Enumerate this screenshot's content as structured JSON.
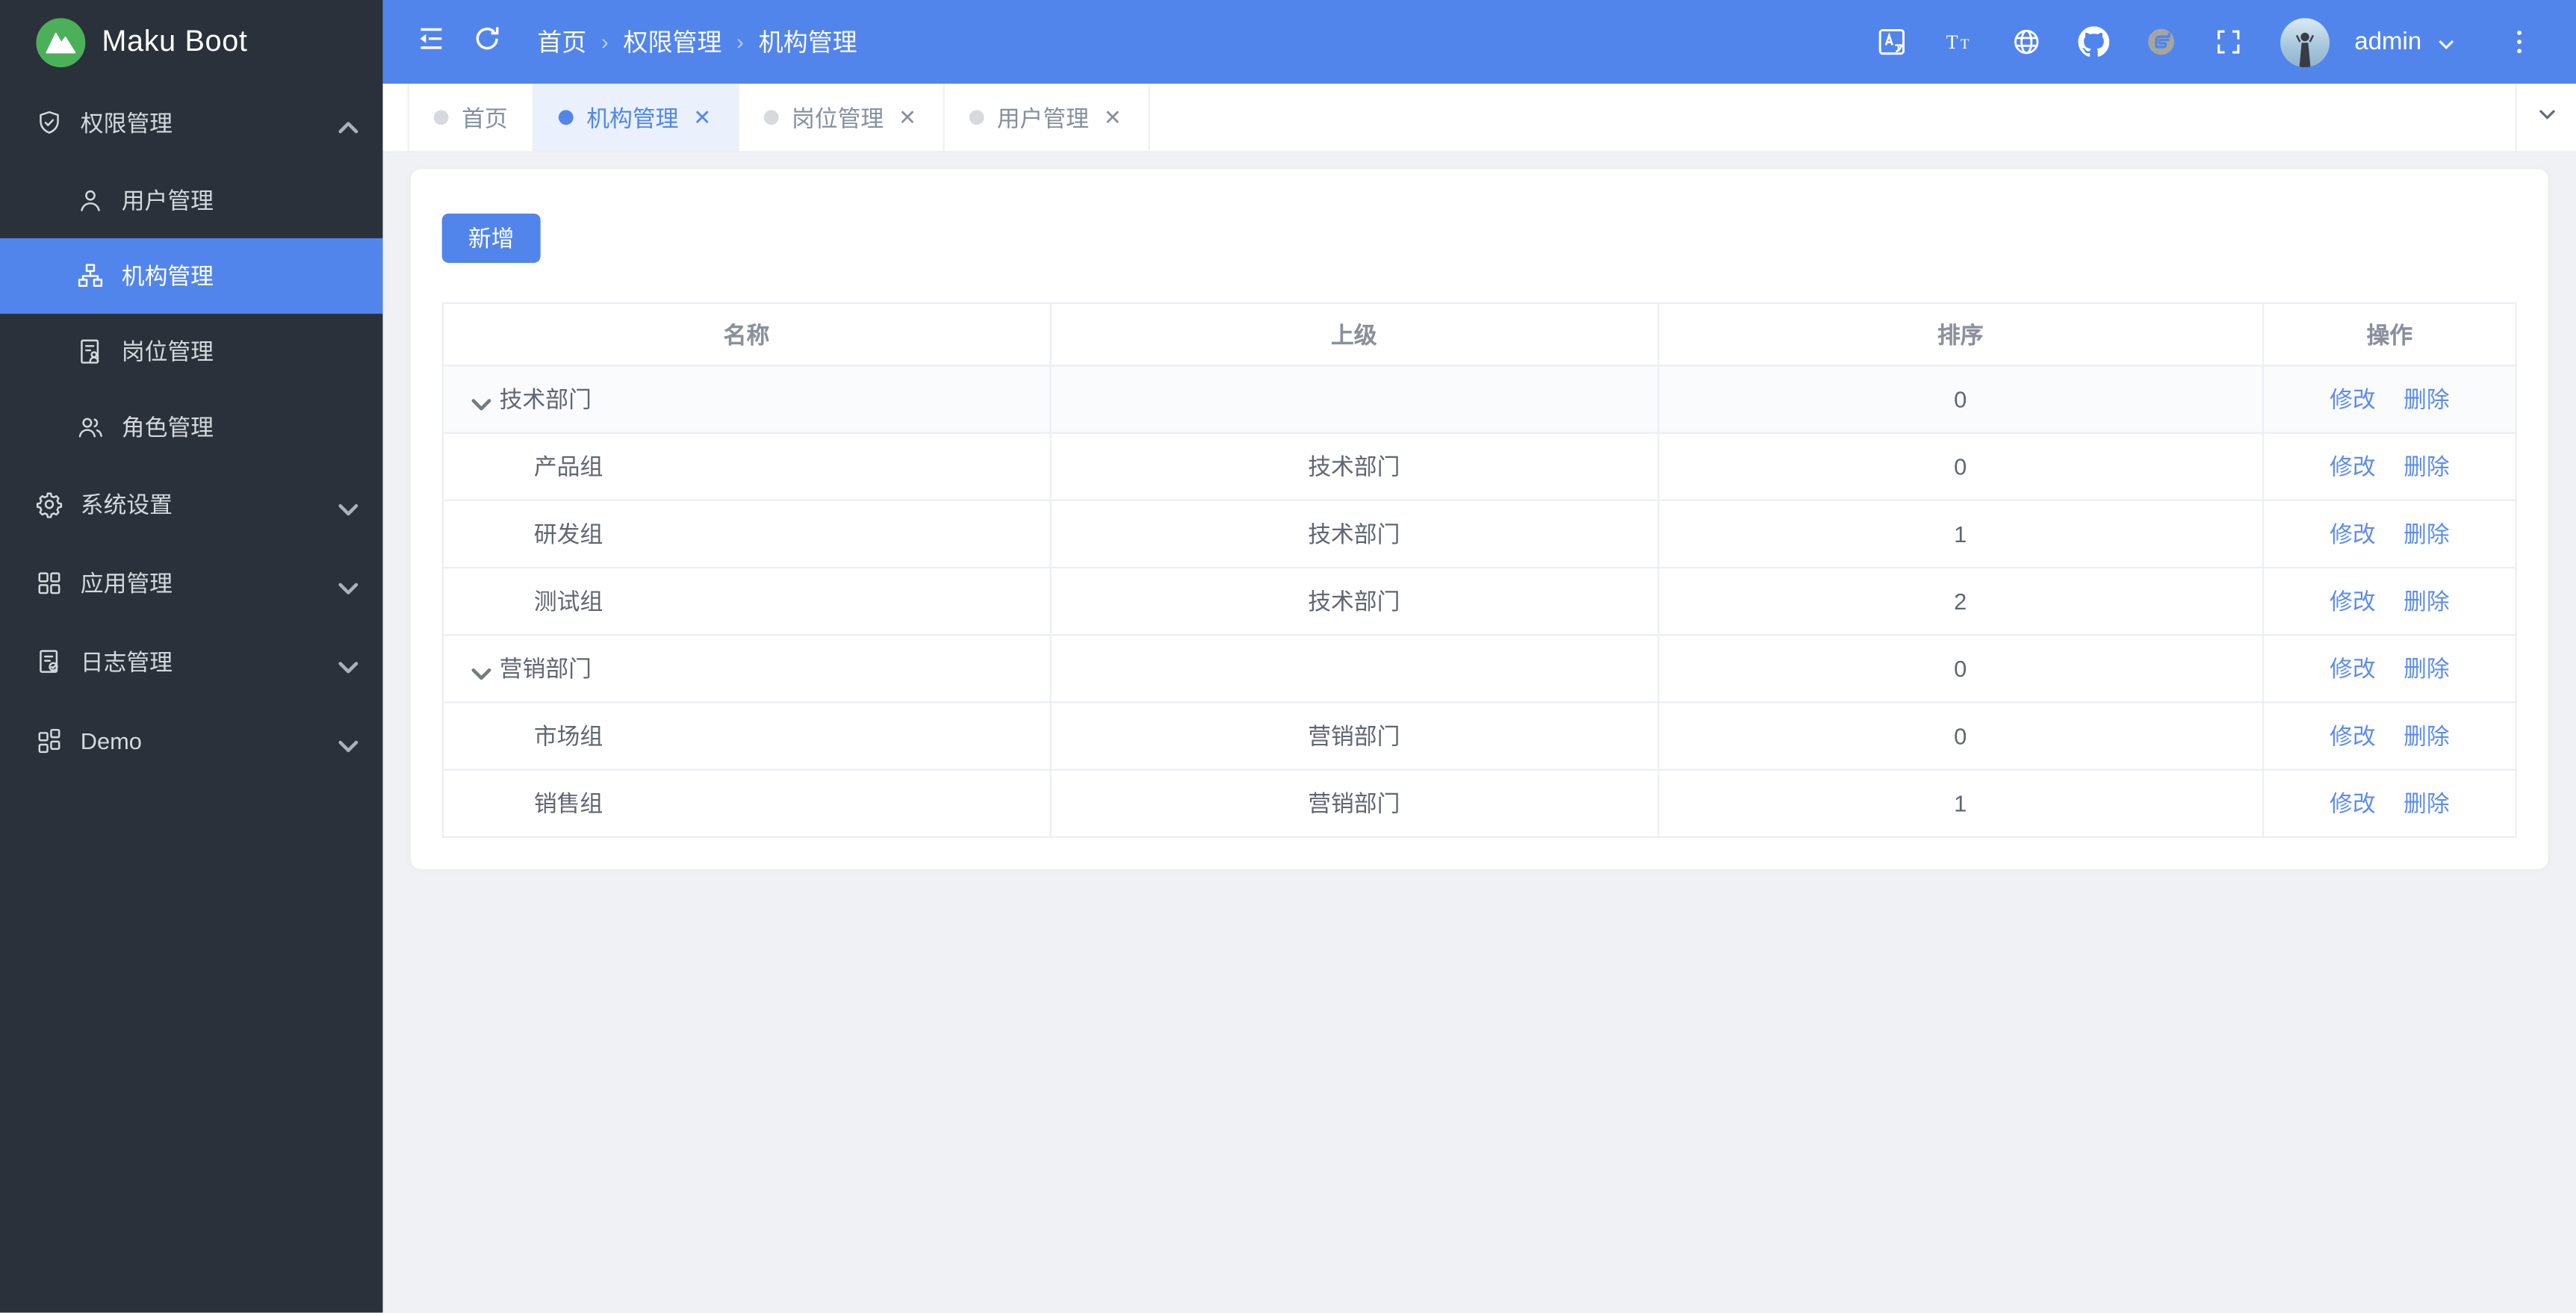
{
  "app": {
    "name": "Maku Boot"
  },
  "colors": {
    "primary": "#5285ec",
    "sidebar_bg": "#2a313a",
    "content_bg": "#eff1f5",
    "active_tab_bg": "#eaf1fc",
    "table_border": "#ebeef5",
    "link": "#5d8cee",
    "logo_green": "#4cb05a",
    "gitee_gray": "#a5a59e"
  },
  "sidebar": {
    "items": [
      {
        "key": "permission",
        "label": "权限管理",
        "icon": "shield",
        "type": "group",
        "expanded": true,
        "children": [
          {
            "key": "user",
            "label": "用户管理",
            "icon": "user",
            "active": false
          },
          {
            "key": "org",
            "label": "机构管理",
            "icon": "org",
            "active": true
          },
          {
            "key": "post",
            "label": "岗位管理",
            "icon": "post",
            "active": false
          },
          {
            "key": "role",
            "label": "角色管理",
            "icon": "role",
            "active": false
          }
        ]
      },
      {
        "key": "system",
        "label": "系统设置",
        "icon": "gear",
        "type": "group",
        "expanded": false,
        "children": []
      },
      {
        "key": "apps",
        "label": "应用管理",
        "icon": "apps",
        "type": "group",
        "expanded": false,
        "children": []
      },
      {
        "key": "logs",
        "label": "日志管理",
        "icon": "log",
        "type": "group",
        "expanded": false,
        "children": []
      },
      {
        "key": "demo",
        "label": "Demo",
        "icon": "demo",
        "type": "group",
        "expanded": false,
        "children": []
      }
    ]
  },
  "header": {
    "breadcrumb": [
      "首页",
      "权限管理",
      "机构管理"
    ],
    "right_icons": [
      "translate",
      "fontsize",
      "globe",
      "github",
      "gitee",
      "fullscreen"
    ],
    "user": {
      "name": "admin"
    }
  },
  "tabs": [
    {
      "key": "home",
      "label": "首页",
      "active": false,
      "closable": false
    },
    {
      "key": "org",
      "label": "机构管理",
      "active": true,
      "closable": true
    },
    {
      "key": "post",
      "label": "岗位管理",
      "active": false,
      "closable": true
    },
    {
      "key": "user",
      "label": "用户管理",
      "active": false,
      "closable": true
    }
  ],
  "main": {
    "add_button": "新增",
    "table": {
      "columns": [
        "名称",
        "上级",
        "排序",
        "操作"
      ],
      "action_labels": [
        "修改",
        "删除"
      ],
      "rows": [
        {
          "name": "技术部门",
          "parent": "",
          "sort": "0",
          "level": 0,
          "expandable": true,
          "hovered": true
        },
        {
          "name": "产品组",
          "parent": "技术部门",
          "sort": "0",
          "level": 1,
          "expandable": false,
          "hovered": false
        },
        {
          "name": "研发组",
          "parent": "技术部门",
          "sort": "1",
          "level": 1,
          "expandable": false,
          "hovered": false
        },
        {
          "name": "测试组",
          "parent": "技术部门",
          "sort": "2",
          "level": 1,
          "expandable": false,
          "hovered": false
        },
        {
          "name": "营销部门",
          "parent": "",
          "sort": "0",
          "level": 0,
          "expandable": true,
          "hovered": false
        },
        {
          "name": "市场组",
          "parent": "营销部门",
          "sort": "0",
          "level": 1,
          "expandable": false,
          "hovered": false
        },
        {
          "name": "销售组",
          "parent": "营销部门",
          "sort": "1",
          "level": 1,
          "expandable": false,
          "hovered": false
        }
      ]
    }
  }
}
